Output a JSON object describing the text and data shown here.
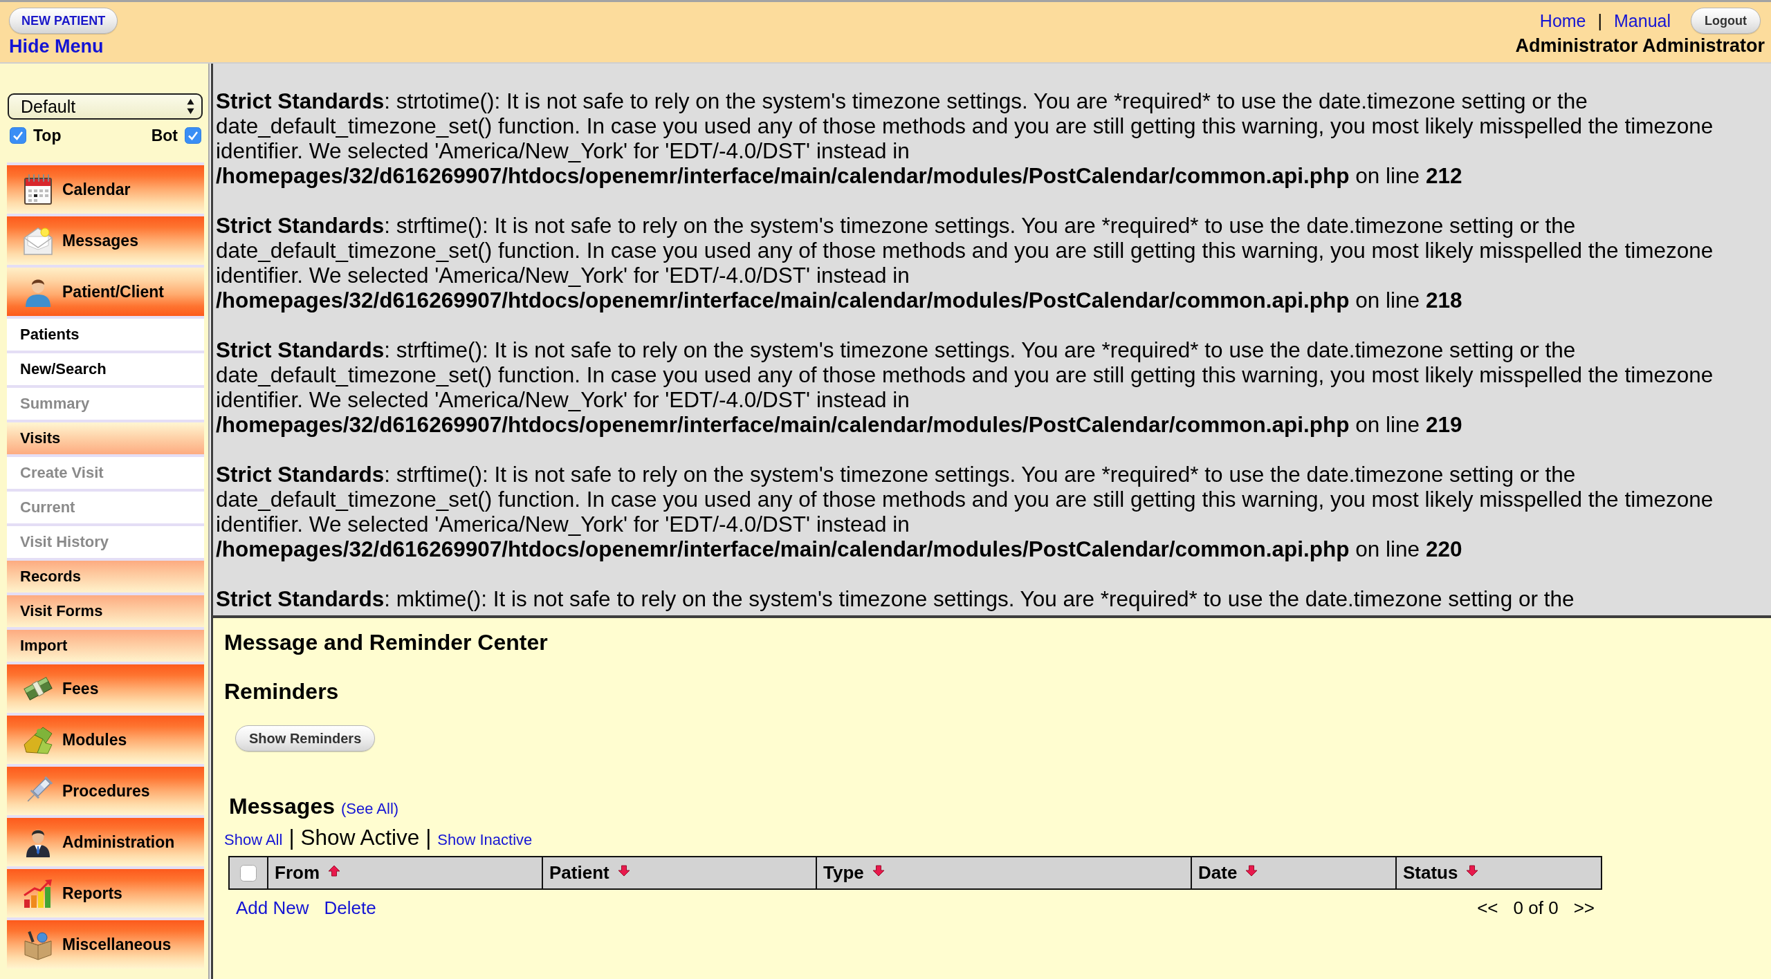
{
  "header": {
    "new_patient_button": "NEW PATIENT",
    "hide_menu_link": "Hide Menu",
    "links": [
      "Home",
      "Manual"
    ],
    "link_separator": "|",
    "logout_button": "Logout",
    "user_name": "Administrator Administrator"
  },
  "sidebar": {
    "view_select": "Default",
    "frame_toggles": [
      {
        "label": "Top",
        "checked": true
      },
      {
        "label": "Bot",
        "checked": true
      }
    ],
    "menu": [
      {
        "label": "Calendar",
        "expanded": false
      },
      {
        "label": "Messages",
        "expanded": false
      },
      {
        "label": "Patient/Client",
        "expanded": true,
        "children": [
          {
            "kind": "link",
            "label": "Patients",
            "disabled": false
          },
          {
            "kind": "link",
            "label": "New/Search",
            "disabled": false
          },
          {
            "kind": "link",
            "label": "Summary",
            "disabled": true
          },
          {
            "kind": "group",
            "label": "Visits",
            "expanded": true,
            "children": [
              {
                "kind": "link",
                "label": "Create Visit",
                "disabled": true
              },
              {
                "kind": "link",
                "label": "Current",
                "disabled": true
              },
              {
                "kind": "link",
                "label": "Visit History",
                "disabled": true
              }
            ]
          },
          {
            "kind": "group",
            "label": "Records",
            "expanded": false
          },
          {
            "kind": "group",
            "label": "Visit Forms",
            "expanded": false
          },
          {
            "kind": "group",
            "label": "Import",
            "expanded": false
          }
        ]
      },
      {
        "label": "Fees",
        "expanded": false
      },
      {
        "label": "Modules",
        "expanded": false
      },
      {
        "label": "Procedures",
        "expanded": false
      },
      {
        "label": "Administration",
        "expanded": false
      },
      {
        "label": "Reports",
        "expanded": false
      },
      {
        "label": "Miscellaneous",
        "expanded": false
      }
    ]
  },
  "warnings": [
    {
      "label": "Strict Standards",
      "message": ": strtotime(): It is not safe to rely on the system's timezone settings. You are *required* to use the date.timezone setting or the date_default_timezone_set() function. In case you used any of those methods and you are still getting this warning, you most likely misspelled the timezone identifier. We selected 'America/New_York' for 'EDT/-4.0/DST' instead in",
      "file": "/homepages/32/d616269907/htdocs/openemr/interface/main/calendar/modules/PostCalendar/common.api.php",
      "line_label": "on line",
      "line": "212"
    },
    {
      "label": "Strict Standards",
      "message": ": strftime(): It is not safe to rely on the system's timezone settings. You are *required* to use the date.timezone setting or the date_default_timezone_set() function. In case you used any of those methods and you are still getting this warning, you most likely misspelled the timezone identifier. We selected 'America/New_York' for 'EDT/-4.0/DST' instead in",
      "file": "/homepages/32/d616269907/htdocs/openemr/interface/main/calendar/modules/PostCalendar/common.api.php",
      "line_label": "on line",
      "line": "218"
    },
    {
      "label": "Strict Standards",
      "message": ": strftime(): It is not safe to rely on the system's timezone settings. You are *required* to use the date.timezone setting or the date_default_timezone_set() function. In case you used any of those methods and you are still getting this warning, you most likely misspelled the timezone identifier. We selected 'America/New_York' for 'EDT/-4.0/DST' instead in",
      "file": "/homepages/32/d616269907/htdocs/openemr/interface/main/calendar/modules/PostCalendar/common.api.php",
      "line_label": "on line",
      "line": "219"
    },
    {
      "label": "Strict Standards",
      "message": ": strftime(): It is not safe to rely on the system's timezone settings. You are *required* to use the date.timezone setting or the date_default_timezone_set() function. In case you used any of those methods and you are still getting this warning, you most likely misspelled the timezone identifier. We selected 'America/New_York' for 'EDT/-4.0/DST' instead in",
      "file": "/homepages/32/d616269907/htdocs/openemr/interface/main/calendar/modules/PostCalendar/common.api.php",
      "line_label": "on line",
      "line": "220"
    },
    {
      "label": "Strict Standards",
      "message": ": mktime(): It is not safe to rely on the system's timezone settings. You are *required* to use the date.timezone setting or the"
    }
  ],
  "message_center": {
    "title": "Message and Reminder Center",
    "reminders": {
      "heading": "Reminders",
      "button": "Show Reminders"
    },
    "messages": {
      "heading": "Messages",
      "see_all": "(See All)",
      "filters": [
        {
          "label": "Show All",
          "selected": false
        },
        {
          "label": "Show Active",
          "selected": true
        },
        {
          "label": "Show Inactive",
          "selected": false
        }
      ],
      "filter_separator": "|",
      "select_all": {
        "checked": false
      },
      "columns": [
        {
          "label": "From",
          "ascending": true
        },
        {
          "label": "Patient",
          "ascending": false
        },
        {
          "label": "Type",
          "ascending": false
        },
        {
          "label": "Date",
          "ascending": false
        },
        {
          "label": "Status",
          "ascending": false
        }
      ],
      "actions": [
        "Add New",
        "Delete"
      ],
      "pager": {
        "previous": "<<",
        "status": "0 of 0",
        "next": ">>"
      }
    }
  }
}
